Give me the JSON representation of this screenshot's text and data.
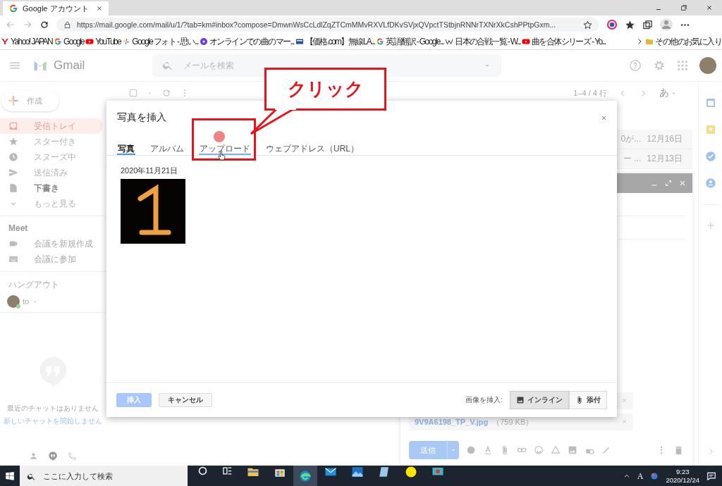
{
  "browser": {
    "tab_title": "Google アカウント",
    "url": "https://mail.google.com/mail/u/1/?tab=km#inbox?compose=DmwnWsCcLdlZqZTCmMMvRXVLfDKvSVjxQVpctTStbjnRNNrTXNrXkCshPPtpGxm...",
    "bookmarks": [
      {
        "label": "Yahoo! JAPAN",
        "kind": "yahoo"
      },
      {
        "label": "Google",
        "kind": "google"
      },
      {
        "label": "YouTube",
        "kind": "youtube"
      },
      {
        "label": "Google フォト - 思い...",
        "kind": "photos"
      },
      {
        "label": "オンラインでの曲のマー...",
        "kind": "music"
      },
      {
        "label": "【価格.com】無線LA...",
        "kind": "kakaku"
      },
      {
        "label": "英語翻訳 - Google...",
        "kind": "google"
      },
      {
        "label": "日本の合戦一覧 - W...",
        "kind": "wiki"
      },
      {
        "label": "曲を合体シリーズ - Yo...",
        "kind": "youtube"
      }
    ],
    "other_bookmarks": "その他のお気に入り"
  },
  "gmail": {
    "logo": "Gmail",
    "search_placeholder": "メールを検索",
    "compose_button": "作成",
    "nav": [
      {
        "label": "受信トレイ",
        "kind": "inbox",
        "selected": true,
        "bold": false
      },
      {
        "label": "スター付き",
        "kind": "star",
        "selected": false,
        "bold": false
      },
      {
        "label": "スヌーズ中",
        "kind": "clock",
        "selected": false,
        "bold": false
      },
      {
        "label": "送信済み",
        "kind": "send",
        "selected": false,
        "bold": false
      },
      {
        "label": "下書き",
        "kind": "draft",
        "selected": false,
        "bold": true
      },
      {
        "label": "もっと見る",
        "kind": "chevron",
        "selected": false,
        "bold": false
      }
    ],
    "meet": {
      "title": "Meet",
      "items": [
        {
          "label": "会議を新規作成",
          "kind": "video"
        },
        {
          "label": "会議に参加",
          "kind": "keyboard"
        }
      ]
    },
    "hangouts": {
      "title": "ハングアウト",
      "user": "to",
      "empty_text": "最近のチャットはありません",
      "start_link": "新しいチャットを開始しません"
    },
    "list": {
      "range": "1–4 / 4 行",
      "input_tool": "あ",
      "rows": [
        {
          "snippet": "0が...",
          "date": "12月16日"
        },
        {
          "snippet": "ー ...",
          "date": "12月13日"
        }
      ]
    },
    "compose": {
      "attachments": [
        {
          "kind": "covered"
        },
        {
          "kind": "file",
          "name": "9V9A6198_TP_V.jpg",
          "size": "（759 KB）"
        }
      ],
      "send": "送信"
    }
  },
  "dialog": {
    "title": "写真を挿入",
    "tabs": [
      {
        "label": "写真",
        "selected": true,
        "pressed": false
      },
      {
        "label": "アルバム",
        "selected": false,
        "pressed": false
      },
      {
        "label": "アップロード",
        "selected": false,
        "pressed": true
      },
      {
        "label": "ウェブアドレス（URL）",
        "selected": false,
        "pressed": false
      }
    ],
    "date": "2020年11月21日",
    "insert": "挿入",
    "insert_disabled": true,
    "cancel": "キャンセル",
    "mode_label": "画像を挿入:",
    "modes": [
      {
        "label": "インライン",
        "kind": "image",
        "selected": true
      },
      {
        "label": "添付",
        "kind": "clip",
        "selected": false
      }
    ]
  },
  "callout": {
    "text": "クリック"
  },
  "taskbar": {
    "search_placeholder": "ここに入力して検索",
    "ime": "A",
    "time": "9:23",
    "date": "2020/12/24"
  }
}
